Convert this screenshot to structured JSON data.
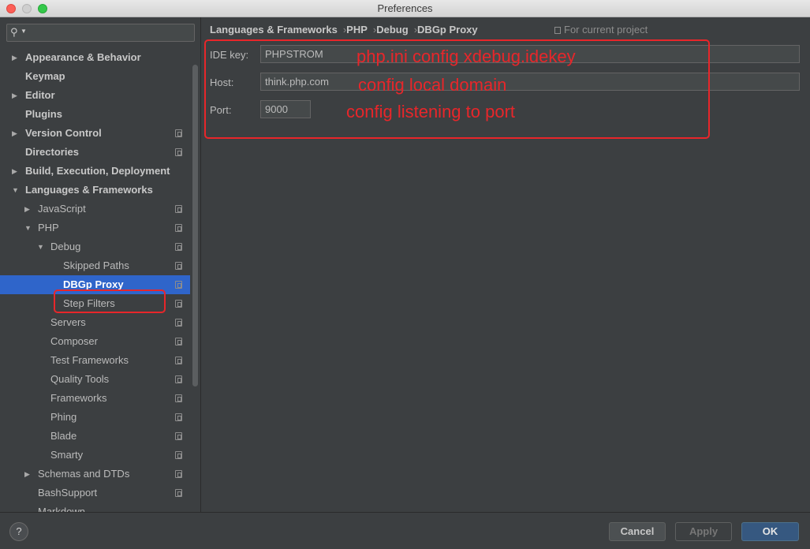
{
  "window": {
    "title": "Preferences"
  },
  "sidebar": {
    "search_value": "",
    "items": [
      {
        "label": "Appearance & Behavior",
        "arrow": "▶"
      },
      {
        "label": "Keymap",
        "arrow": ""
      },
      {
        "label": "Editor",
        "arrow": "▶"
      },
      {
        "label": "Plugins",
        "arrow": ""
      },
      {
        "label": "Version Control",
        "arrow": "▶"
      },
      {
        "label": "Directories",
        "arrow": ""
      },
      {
        "label": "Build, Execution, Deployment",
        "arrow": "▶"
      },
      {
        "label": "Languages & Frameworks",
        "arrow": "▼"
      },
      {
        "label": "JavaScript",
        "arrow": "▶"
      },
      {
        "label": "PHP",
        "arrow": "▼"
      },
      {
        "label": "Debug",
        "arrow": "▼"
      },
      {
        "label": "Skipped Paths",
        "arrow": ""
      },
      {
        "label": "DBGp Proxy",
        "arrow": ""
      },
      {
        "label": "Step Filters",
        "arrow": ""
      },
      {
        "label": "Servers",
        "arrow": ""
      },
      {
        "label": "Composer",
        "arrow": ""
      },
      {
        "label": "Test Frameworks",
        "arrow": ""
      },
      {
        "label": "Quality Tools",
        "arrow": ""
      },
      {
        "label": "Frameworks",
        "arrow": ""
      },
      {
        "label": "Phing",
        "arrow": ""
      },
      {
        "label": "Blade",
        "arrow": ""
      },
      {
        "label": "Smarty",
        "arrow": ""
      },
      {
        "label": "Schemas and DTDs",
        "arrow": "▶"
      },
      {
        "label": "BashSupport",
        "arrow": ""
      },
      {
        "label": "Markdown",
        "arrow": ""
      }
    ]
  },
  "breadcrumb": {
    "items": [
      "Languages & Frameworks",
      "PHP",
      "Debug",
      "DBGp Proxy"
    ],
    "separator": "›",
    "for_project": "For current project"
  },
  "form": {
    "ide_key_label": "IDE key:",
    "ide_key_value": "PHPSTROM",
    "host_label": "Host:",
    "host_value": "think.php.com",
    "port_label": "Port:",
    "port_value": "9000"
  },
  "annotations": {
    "ide_key_note": "php.ini config xdebug.idekey",
    "host_note": "config local domain",
    "port_note": "config listening to port",
    "color": "#e8262a"
  },
  "footer": {
    "help_label": "?",
    "cancel_label": "Cancel",
    "apply_label": "Apply",
    "ok_label": "OK"
  },
  "colors": {
    "selection": "#2f65ca",
    "ok_button": "#365880",
    "background": "#3c3f41"
  }
}
